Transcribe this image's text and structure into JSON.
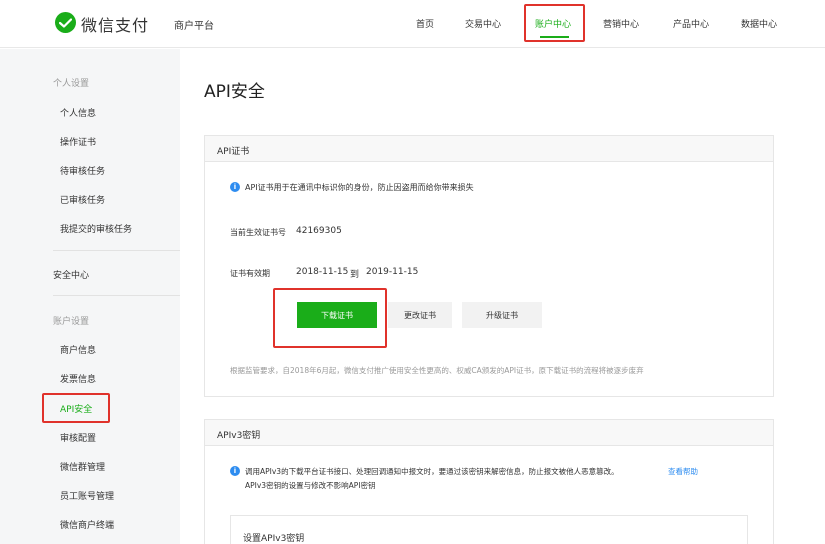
{
  "header": {
    "brand": "微信支付",
    "platform": "商户平台",
    "nav": [
      {
        "label": "首页"
      },
      {
        "label": "交易中心"
      },
      {
        "label": "账户中心"
      },
      {
        "label": "营销中心"
      },
      {
        "label": "产品中心"
      },
      {
        "label": "数据中心"
      }
    ]
  },
  "sidebar": {
    "personal_group": "个人设置",
    "personal_items": [
      "个人信息",
      "操作证书",
      "待审核任务",
      "已审核任务",
      "我提交的审核任务"
    ],
    "security_center": "安全中心",
    "account_group": "账户设置",
    "account_items": [
      "商户信息",
      "发票信息",
      "API安全",
      "审核配置",
      "微信群管理",
      "员工账号管理",
      "微信商户终端"
    ]
  },
  "main": {
    "title": "API安全",
    "cert_panel": {
      "heading": "API证书",
      "info": "API证书用于在通讯中标识你的身份，防止因盗用而给你带来损失",
      "serial_label": "当前生效证书号",
      "serial_value": "42169305",
      "validity_label": "证书有效期",
      "validity_start": "2018-11-15",
      "validity_to": "到",
      "validity_end": "2019-11-15",
      "download_button": "下载证书",
      "change_button": "更改证书",
      "upgrade_button": "升级证书",
      "notice": "根据监管要求，自2018年6月起，微信支付推广使用安全性更高的、权威CA颁发的API证书，原下载证书的流程将被逐步废弃"
    },
    "v3_panel": {
      "heading": "APIv3密钥",
      "info_line1": "调用APIv3的下载平台证书接口、处理回调通知中报文时，要通过该密钥来解密信息，防止报文被他人恶意篡改。",
      "help_link": "查看帮助",
      "info_line2": "APIv3密钥的设置与修改不影响API密钥",
      "sub_title": "设置APIv3密钥"
    }
  }
}
